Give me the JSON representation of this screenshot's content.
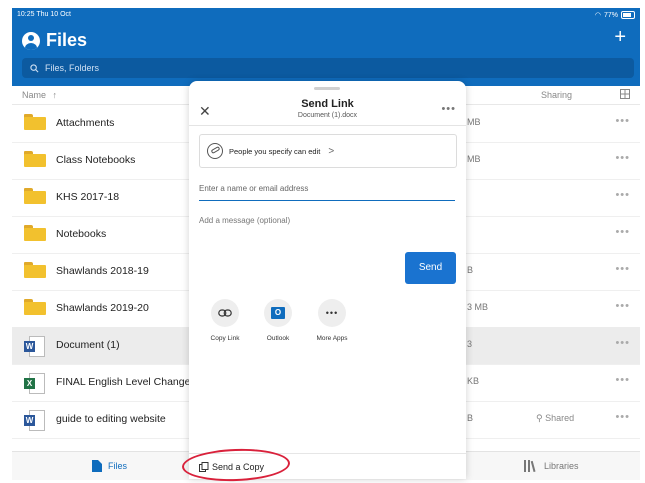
{
  "status_bar": {
    "time_date": "10:25  Thu 10 Oct",
    "battery": "77%"
  },
  "header": {
    "title": "Files",
    "add_label": "+",
    "search_placeholder": "Files, Folders"
  },
  "columns": {
    "name": "Name",
    "sort_arrow": "↑",
    "sharing": "Sharing"
  },
  "rows": [
    {
      "name": "Attachments",
      "type": "folder",
      "size": "MB",
      "sharing": ""
    },
    {
      "name": "Class Notebooks",
      "type": "folder",
      "size": "MB",
      "sharing": ""
    },
    {
      "name": "KHS 2017-18",
      "type": "folder",
      "size": "",
      "sharing": ""
    },
    {
      "name": "Notebooks",
      "type": "folder",
      "size": "",
      "sharing": ""
    },
    {
      "name": "Shawlands 2018-19",
      "type": "folder",
      "size": "B",
      "sharing": ""
    },
    {
      "name": "Shawlands 2019-20",
      "type": "folder",
      "size": "3 MB",
      "sharing": ""
    },
    {
      "name": "Document (1)",
      "type": "word",
      "size": "3",
      "sharing": ""
    },
    {
      "name": "FINAL English Level Changes",
      "type": "excel",
      "size": "KB",
      "sharing": ""
    },
    {
      "name": "guide to editing website",
      "type": "word",
      "size": "B",
      "sharing": "Shared"
    }
  ],
  "row_more": "•••",
  "tabbar": {
    "files": "Files",
    "libraries": "Libraries"
  },
  "modal": {
    "title": "Send Link",
    "subtitle": "Document (1).docx",
    "close": "✕",
    "more": "•••",
    "permission": "People you specify can edit",
    "permission_chevron": ">",
    "email_placeholder": "Enter a name or email address",
    "message_placeholder": "Add a message (optional)",
    "send": "Send",
    "options": [
      "Copy Link",
      "Outlook",
      "More Apps"
    ],
    "outlook_badge": "O",
    "more_apps_glyph": "•••",
    "send_copy": "Send a Copy"
  },
  "colors": {
    "brand": "#0f6cbd",
    "send_button": "#1a73d0",
    "highlight": "#d9213b",
    "folder": "#f2c12e",
    "word": "#2b579a",
    "excel": "#217346"
  }
}
